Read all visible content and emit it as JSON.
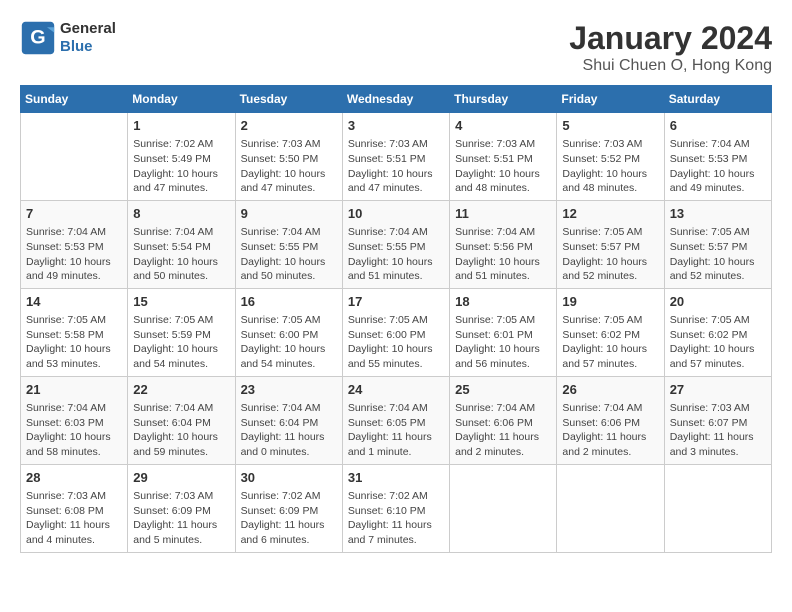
{
  "header": {
    "logo_line1": "General",
    "logo_line2": "Blue",
    "title": "January 2024",
    "subtitle": "Shui Chuen O, Hong Kong"
  },
  "weekdays": [
    "Sunday",
    "Monday",
    "Tuesday",
    "Wednesday",
    "Thursday",
    "Friday",
    "Saturday"
  ],
  "weeks": [
    [
      {
        "day": "",
        "info": ""
      },
      {
        "day": "1",
        "info": "Sunrise: 7:02 AM\nSunset: 5:49 PM\nDaylight: 10 hours and 47 minutes."
      },
      {
        "day": "2",
        "info": "Sunrise: 7:03 AM\nSunset: 5:50 PM\nDaylight: 10 hours and 47 minutes."
      },
      {
        "day": "3",
        "info": "Sunrise: 7:03 AM\nSunset: 5:51 PM\nDaylight: 10 hours and 47 minutes."
      },
      {
        "day": "4",
        "info": "Sunrise: 7:03 AM\nSunset: 5:51 PM\nDaylight: 10 hours and 48 minutes."
      },
      {
        "day": "5",
        "info": "Sunrise: 7:03 AM\nSunset: 5:52 PM\nDaylight: 10 hours and 48 minutes."
      },
      {
        "day": "6",
        "info": "Sunrise: 7:04 AM\nSunset: 5:53 PM\nDaylight: 10 hours and 49 minutes."
      }
    ],
    [
      {
        "day": "7",
        "info": "Sunrise: 7:04 AM\nSunset: 5:53 PM\nDaylight: 10 hours and 49 minutes."
      },
      {
        "day": "8",
        "info": "Sunrise: 7:04 AM\nSunset: 5:54 PM\nDaylight: 10 hours and 50 minutes."
      },
      {
        "day": "9",
        "info": "Sunrise: 7:04 AM\nSunset: 5:55 PM\nDaylight: 10 hours and 50 minutes."
      },
      {
        "day": "10",
        "info": "Sunrise: 7:04 AM\nSunset: 5:55 PM\nDaylight: 10 hours and 51 minutes."
      },
      {
        "day": "11",
        "info": "Sunrise: 7:04 AM\nSunset: 5:56 PM\nDaylight: 10 hours and 51 minutes."
      },
      {
        "day": "12",
        "info": "Sunrise: 7:05 AM\nSunset: 5:57 PM\nDaylight: 10 hours and 52 minutes."
      },
      {
        "day": "13",
        "info": "Sunrise: 7:05 AM\nSunset: 5:57 PM\nDaylight: 10 hours and 52 minutes."
      }
    ],
    [
      {
        "day": "14",
        "info": "Sunrise: 7:05 AM\nSunset: 5:58 PM\nDaylight: 10 hours and 53 minutes."
      },
      {
        "day": "15",
        "info": "Sunrise: 7:05 AM\nSunset: 5:59 PM\nDaylight: 10 hours and 54 minutes."
      },
      {
        "day": "16",
        "info": "Sunrise: 7:05 AM\nSunset: 6:00 PM\nDaylight: 10 hours and 54 minutes."
      },
      {
        "day": "17",
        "info": "Sunrise: 7:05 AM\nSunset: 6:00 PM\nDaylight: 10 hours and 55 minutes."
      },
      {
        "day": "18",
        "info": "Sunrise: 7:05 AM\nSunset: 6:01 PM\nDaylight: 10 hours and 56 minutes."
      },
      {
        "day": "19",
        "info": "Sunrise: 7:05 AM\nSunset: 6:02 PM\nDaylight: 10 hours and 57 minutes."
      },
      {
        "day": "20",
        "info": "Sunrise: 7:05 AM\nSunset: 6:02 PM\nDaylight: 10 hours and 57 minutes."
      }
    ],
    [
      {
        "day": "21",
        "info": "Sunrise: 7:04 AM\nSunset: 6:03 PM\nDaylight: 10 hours and 58 minutes."
      },
      {
        "day": "22",
        "info": "Sunrise: 7:04 AM\nSunset: 6:04 PM\nDaylight: 10 hours and 59 minutes."
      },
      {
        "day": "23",
        "info": "Sunrise: 7:04 AM\nSunset: 6:04 PM\nDaylight: 11 hours and 0 minutes."
      },
      {
        "day": "24",
        "info": "Sunrise: 7:04 AM\nSunset: 6:05 PM\nDaylight: 11 hours and 1 minute."
      },
      {
        "day": "25",
        "info": "Sunrise: 7:04 AM\nSunset: 6:06 PM\nDaylight: 11 hours and 2 minutes."
      },
      {
        "day": "26",
        "info": "Sunrise: 7:04 AM\nSunset: 6:06 PM\nDaylight: 11 hours and 2 minutes."
      },
      {
        "day": "27",
        "info": "Sunrise: 7:03 AM\nSunset: 6:07 PM\nDaylight: 11 hours and 3 minutes."
      }
    ],
    [
      {
        "day": "28",
        "info": "Sunrise: 7:03 AM\nSunset: 6:08 PM\nDaylight: 11 hours and 4 minutes."
      },
      {
        "day": "29",
        "info": "Sunrise: 7:03 AM\nSunset: 6:09 PM\nDaylight: 11 hours and 5 minutes."
      },
      {
        "day": "30",
        "info": "Sunrise: 7:02 AM\nSunset: 6:09 PM\nDaylight: 11 hours and 6 minutes."
      },
      {
        "day": "31",
        "info": "Sunrise: 7:02 AM\nSunset: 6:10 PM\nDaylight: 11 hours and 7 minutes."
      },
      {
        "day": "",
        "info": ""
      },
      {
        "day": "",
        "info": ""
      },
      {
        "day": "",
        "info": ""
      }
    ]
  ]
}
